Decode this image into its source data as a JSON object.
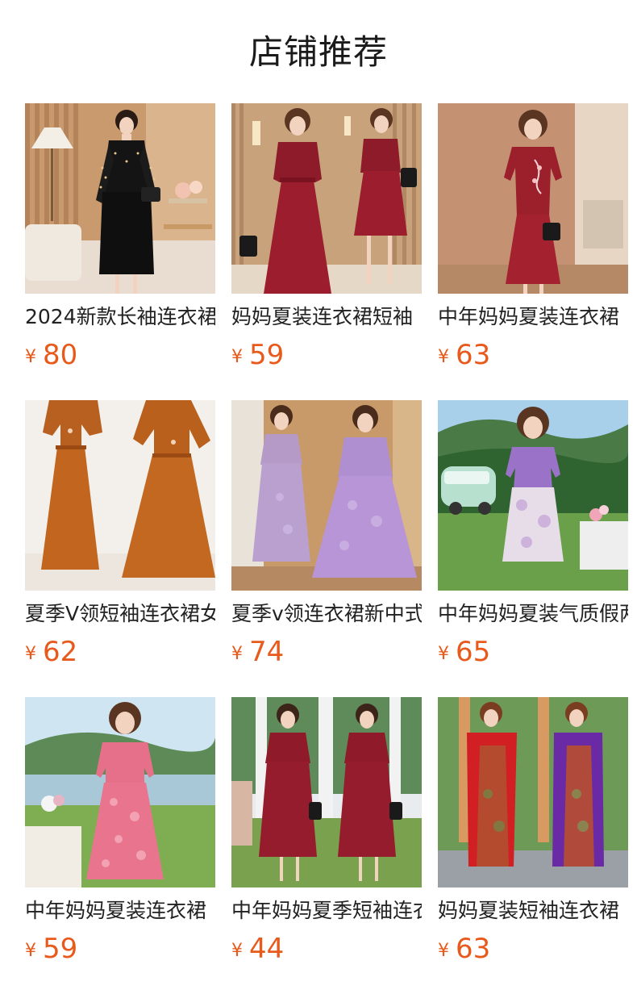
{
  "header": {
    "title": "店铺推荐"
  },
  "currency_symbol": "¥",
  "products": [
    {
      "name": "2024新款长袖连衣裙",
      "price": "80",
      "image": "woman-black-dress-polka-sleeves-photo"
    },
    {
      "name": "妈妈夏装连衣裙短袖",
      "price": "59",
      "image": "two-women-burgundy-dress-photo"
    },
    {
      "name": "中年妈妈夏装连衣裙",
      "price": "63",
      "image": "woman-red-embroidered-dress-photo"
    },
    {
      "name": "夏季V领短袖连衣裙女",
      "price": "62",
      "image": "two-women-caramel-dress-photo"
    },
    {
      "name": "夏季v领连衣裙新中式",
      "price": "74",
      "image": "two-women-lavender-dress-photo"
    },
    {
      "name": "中年妈妈夏装气质假两件",
      "price": "65",
      "image": "woman-purple-top-floral-skirt-outdoor-photo"
    },
    {
      "name": "中年妈妈夏装连衣裙",
      "price": "59",
      "image": "woman-pink-lace-dress-lakeside-photo"
    },
    {
      "name": "中年妈妈夏季短袖连衣裙",
      "price": "44",
      "image": "two-women-wine-dress-garden-photo"
    },
    {
      "name": "妈妈夏装短袖连衣裙",
      "price": "63",
      "image": "two-women-red-purple-dress-photo"
    }
  ],
  "colors": {
    "price": "#e85a1b",
    "title": "#1a1a1a"
  }
}
